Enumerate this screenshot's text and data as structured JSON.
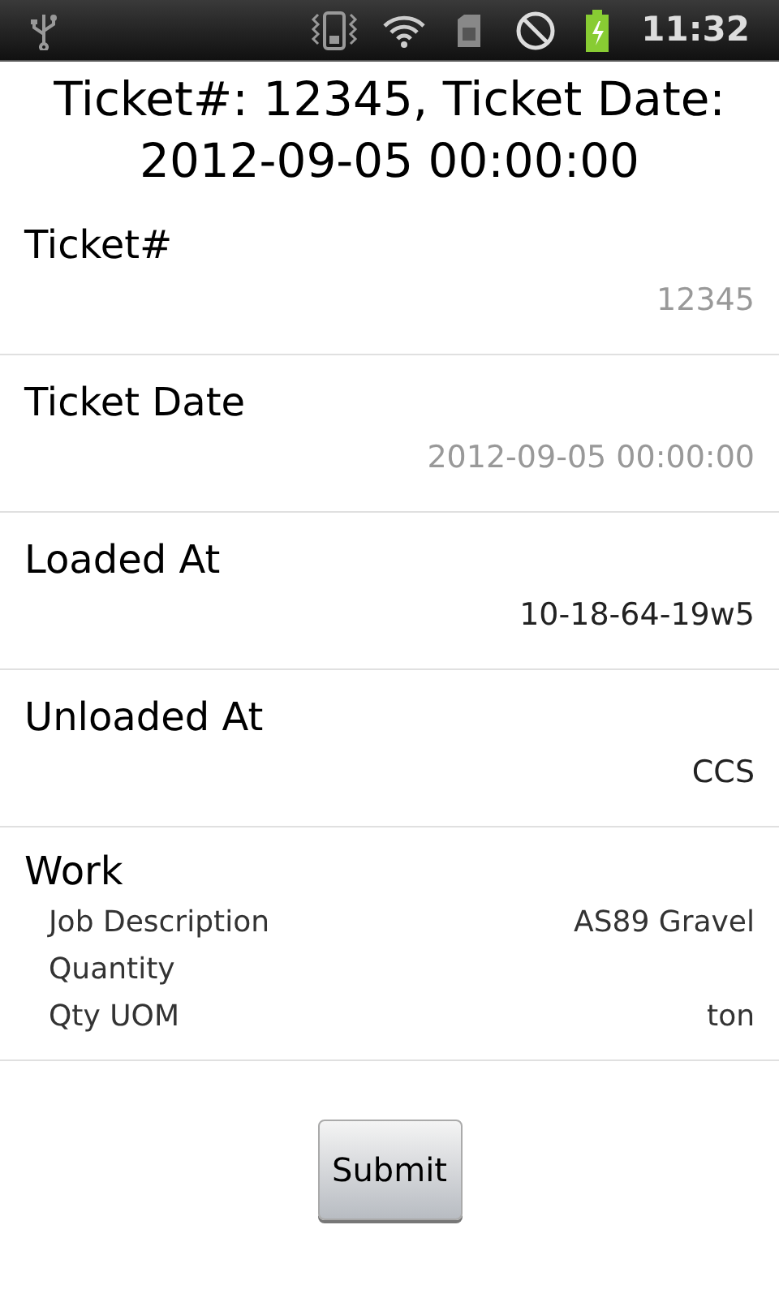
{
  "status_bar": {
    "time": "11:32"
  },
  "title": "Ticket#: 12345, Ticket Date: 2012-09-05 00:00:00",
  "fields": [
    {
      "label": "Ticket#",
      "value": "12345",
      "disabled": true
    },
    {
      "label": "Ticket Date",
      "value": "2012-09-05 00:00:00",
      "disabled": true
    },
    {
      "label": "Loaded At",
      "value": "10-18-64-19w5",
      "disabled": false
    },
    {
      "label": "Unloaded At",
      "value": "CCS",
      "disabled": false
    }
  ],
  "work": {
    "label": "Work",
    "rows": [
      {
        "label": "Job Description",
        "value": "AS89 Gravel"
      },
      {
        "label": "Quantity"
      },
      {
        "label": "Qty UOM",
        "value": "ton"
      }
    ]
  },
  "button": "Submit"
}
